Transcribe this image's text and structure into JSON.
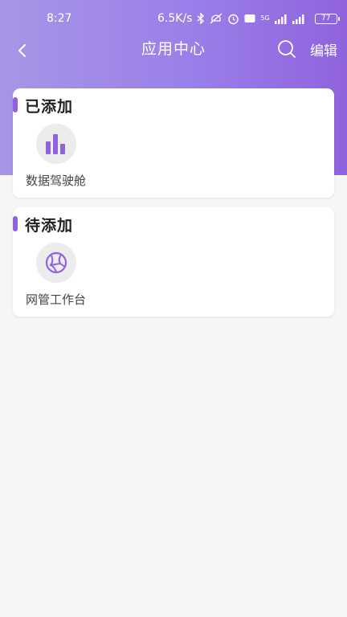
{
  "status_bar": {
    "time": "8:27",
    "net_speed": "6.5K/s",
    "network_label": "5G",
    "battery": "77",
    "icons": [
      "bluetooth-icon",
      "mute-icon",
      "alarm-icon",
      "hd-icon",
      "signal-icon",
      "battery-icon"
    ]
  },
  "header": {
    "title": "应用中心",
    "edit_label": "编辑",
    "back_icon": "chevron-left-icon",
    "search_icon": "search-icon"
  },
  "sections": [
    {
      "title": "已添加",
      "apps": [
        {
          "label": "数据驾驶舱",
          "icon": "bar-chart-icon"
        }
      ]
    },
    {
      "title": "待添加",
      "apps": [
        {
          "label": "网管工作台",
          "icon": "globe-network-icon"
        }
      ]
    }
  ],
  "colors": {
    "accent": "#8f63de",
    "header_gradient_start": "#a796e6",
    "header_gradient_end": "#8f63de",
    "background": "#f6f6f6"
  }
}
